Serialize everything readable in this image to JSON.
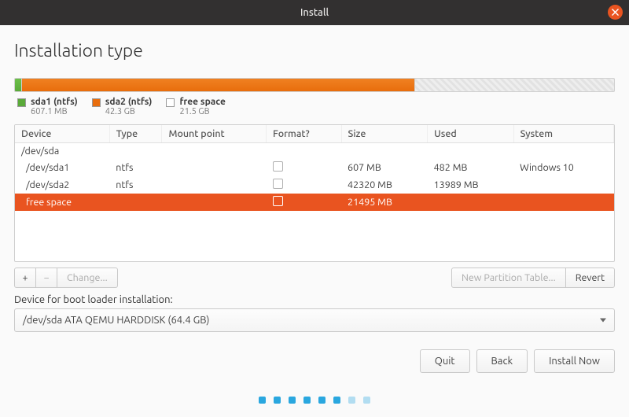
{
  "window": {
    "title": "Install"
  },
  "page": {
    "heading": "Installation type"
  },
  "colors": {
    "accent": "#e95420",
    "sda1": "#5aaa39",
    "sda2": "#e86d0c"
  },
  "disk_bar": {
    "segments": [
      {
        "id": "sda1",
        "label": "sda1 (ntfs)",
        "size": "607.1 MB",
        "percent": 1.2
      },
      {
        "id": "sda2",
        "label": "sda2 (ntfs)",
        "size": "42.3 GB",
        "percent": 65.6
      },
      {
        "id": "free",
        "label": "free space",
        "size": "21.5 GB",
        "percent": 33.2
      }
    ]
  },
  "table": {
    "columns": [
      "Device",
      "Type",
      "Mount point",
      "Format?",
      "Size",
      "Used",
      "System"
    ],
    "rows": [
      {
        "device": "/dev/sda",
        "type": "",
        "mount": "",
        "format": null,
        "size": "",
        "used": "",
        "system": "",
        "level": 0,
        "selected": false
      },
      {
        "device": "/dev/sda1",
        "type": "ntfs",
        "mount": "",
        "format": false,
        "size": "607 MB",
        "used": "482 MB",
        "system": "Windows 10",
        "level": 1,
        "selected": false
      },
      {
        "device": "/dev/sda2",
        "type": "ntfs",
        "mount": "",
        "format": false,
        "size": "42320 MB",
        "used": "13989 MB",
        "system": "",
        "level": 1,
        "selected": false
      },
      {
        "device": "free space",
        "type": "",
        "mount": "",
        "format": false,
        "size": "21495 MB",
        "used": "",
        "system": "",
        "level": 1,
        "selected": true
      }
    ]
  },
  "toolbar": {
    "add": "+",
    "remove": "−",
    "change": "Change...",
    "new_table": "New Partition Table...",
    "revert": "Revert"
  },
  "bootloader": {
    "label": "Device for boot loader installation:",
    "value": "/dev/sda   ATA QEMU HARDDISK (64.4 GB)"
  },
  "buttons": {
    "quit": "Quit",
    "back": "Back",
    "install": "Install Now"
  },
  "progress": {
    "total": 8,
    "current": 6
  }
}
